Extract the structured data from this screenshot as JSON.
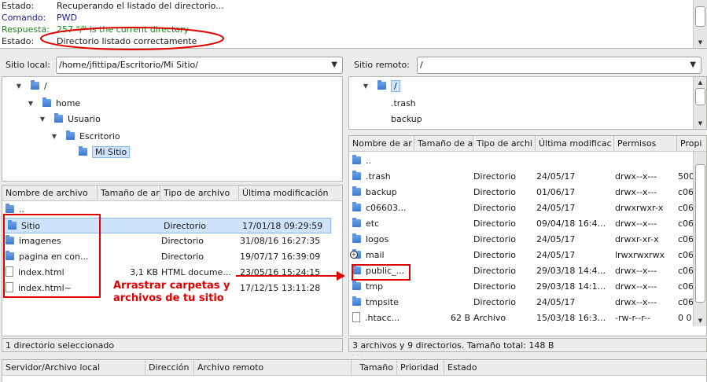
{
  "log": {
    "lines": [
      {
        "key": "Estado:",
        "value": "Recuperando el listado del directorio...",
        "color": "#1a1a1a"
      },
      {
        "key": "Comando:",
        "value": "PWD",
        "color": "#1a1a99"
      },
      {
        "key": "Respuesta:",
        "value": "257 \"/\" is the current directory",
        "color": "#1a8a1a"
      },
      {
        "key": "Estado:",
        "value": "Directorio listado correctamente",
        "color": "#1a1a1a"
      }
    ]
  },
  "local": {
    "label": "Sitio local:",
    "path": "/home/jfittipa/Escritorio/Mi Sitio/",
    "tree": [
      {
        "label": "/",
        "expander": "▼"
      },
      {
        "label": "home",
        "expander": "▼"
      },
      {
        "label": "Usuario",
        "expander": "▼"
      },
      {
        "label": "Escritorio",
        "expander": "▼"
      },
      {
        "label": "Mi Sitio",
        "expander": ""
      }
    ],
    "columns": [
      "Nombre de archivo",
      "Tamaño de ar",
      "Tipo de archivo",
      "Última modificación"
    ],
    "rows": [
      {
        "name": "..",
        "size": "",
        "type": "",
        "modified": "",
        "icon": "folder-icon"
      },
      {
        "name": "Sitio",
        "size": "",
        "type": "Directorio",
        "modified": "17/01/18 09:29:59",
        "icon": "folder-icon"
      },
      {
        "name": "imagenes",
        "size": "",
        "type": "Directorio",
        "modified": "31/08/16 16:27:35",
        "icon": "folder-icon"
      },
      {
        "name": "pagina en con...",
        "size": "",
        "type": "Directorio",
        "modified": "19/07/17 16:39:09",
        "icon": "folder-icon"
      },
      {
        "name": "index.html",
        "size": "3,1 KB",
        "type": "HTML docume...",
        "modified": "23/05/16 15:24:15",
        "icon": "file-icon"
      },
      {
        "name": "index.html~",
        "size": "",
        "type": "",
        "modified": "17/12/15 13:11:28",
        "icon": "file-icon"
      }
    ],
    "status": "1 directorio seleccionado"
  },
  "remote": {
    "label": "Sitio remoto:",
    "path": "/",
    "tree": [
      {
        "label": "/",
        "expander": "▼"
      },
      {
        "label": ".trash",
        "expander": ""
      },
      {
        "label": "backup",
        "expander": ""
      }
    ],
    "columns": [
      "Nombre de ar",
      "Tamaño de a",
      "Tipo de archi",
      "Última modificac",
      "Permisos",
      "Propi"
    ],
    "rows": [
      {
        "name": "..",
        "size": "",
        "type": "",
        "modified": "",
        "perms": "",
        "owner": "",
        "icon": "folder-icon"
      },
      {
        "name": ".trash",
        "size": "",
        "type": "Directorio",
        "modified": "24/05/17",
        "perms": "drwx--x---",
        "owner": "500",
        "icon": "folder-icon"
      },
      {
        "name": "backup",
        "size": "",
        "type": "Directorio",
        "modified": "01/06/17",
        "perms": "drwx--x---",
        "owner": "c06",
        "icon": "folder-icon"
      },
      {
        "name": "c06603...",
        "size": "",
        "type": "Directorio",
        "modified": "24/05/17",
        "perms": "drwxrwxr-x",
        "owner": "c06",
        "icon": "folder-icon"
      },
      {
        "name": "etc",
        "size": "",
        "type": "Directorio",
        "modified": "09/04/18 16:4...",
        "perms": "drwx--x---",
        "owner": "c06",
        "icon": "folder-icon"
      },
      {
        "name": "logos",
        "size": "",
        "type": "Directorio",
        "modified": "24/05/17",
        "perms": "drwxr-xr-x",
        "owner": "c06",
        "icon": "folder-icon"
      },
      {
        "name": "mail",
        "size": "",
        "type": "Directorio",
        "modified": "24/05/17",
        "perms": "lrwxrwxrwx",
        "owner": "c06",
        "icon": "folder-icon"
      },
      {
        "name": "public_...",
        "size": "",
        "type": "Directorio",
        "modified": "29/03/18 14:4...",
        "perms": "drwx--x---",
        "owner": "c06",
        "icon": "folder-icon"
      },
      {
        "name": "tmp",
        "size": "",
        "type": "Directorio",
        "modified": "29/03/18 14:1...",
        "perms": "drwx--x---",
        "owner": "c06",
        "icon": "folder-icon"
      },
      {
        "name": "tmpsite",
        "size": "",
        "type": "Directorio",
        "modified": "24/05/17",
        "perms": "drwx--x---",
        "owner": "c06",
        "icon": "folder-icon"
      },
      {
        "name": ".htacc...",
        "size": "62 B",
        "type": "Archivo",
        "modified": "15/03/18 16:3...",
        "perms": "-rw-r--r--",
        "owner": "0 0",
        "icon": "file-icon"
      }
    ],
    "status": "3 archivos y 9 directorios. Tamaño total: 148 B"
  },
  "queue": {
    "columns": [
      "Servidor/Archivo local",
      "Dirección",
      "Archivo remoto",
      "Tamaño",
      "Prioridad",
      "Estado"
    ]
  },
  "annotation": {
    "text_line1": "Arrastrar carpetas y",
    "text_line2": "archivos de tu sitio"
  },
  "colors": {
    "annotation": "#e00000",
    "selection": "#cfe3fb",
    "folder": "#3b78cf"
  }
}
